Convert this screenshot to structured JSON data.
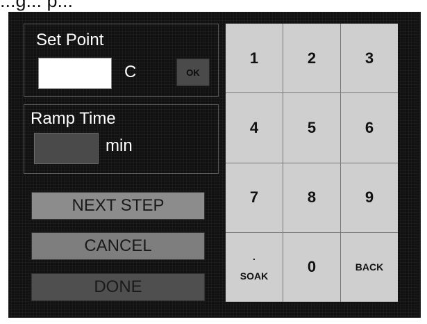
{
  "header": {
    "caption": "...g... p..."
  },
  "setpoint": {
    "label": "Set Point",
    "unit": "C",
    "value": "",
    "ok_label": "OK"
  },
  "ramp": {
    "label": "Ramp Time",
    "unit": "min",
    "value": ""
  },
  "actions": {
    "next_step": "NEXT STEP",
    "cancel": "CANCEL",
    "done": "DONE"
  },
  "keypad": {
    "k1": "1",
    "k2": "2",
    "k3": "3",
    "k4": "4",
    "k5": "5",
    "k6": "6",
    "k7": "7",
    "k8": "8",
    "k9": "9",
    "dot": ".",
    "soak": "SOAK",
    "k0": "0",
    "back": "BACK"
  },
  "colors": {
    "panel_bg": "#111111",
    "key_bg": "#cfcfcf",
    "next_step_bg": "#8c8c8c",
    "cancel_bg": "#7e7e7e",
    "done_bg": "#4f4f4f",
    "setpoint_field_bg": "#ffffff",
    "ramp_field_bg": "#4a4a4a"
  }
}
